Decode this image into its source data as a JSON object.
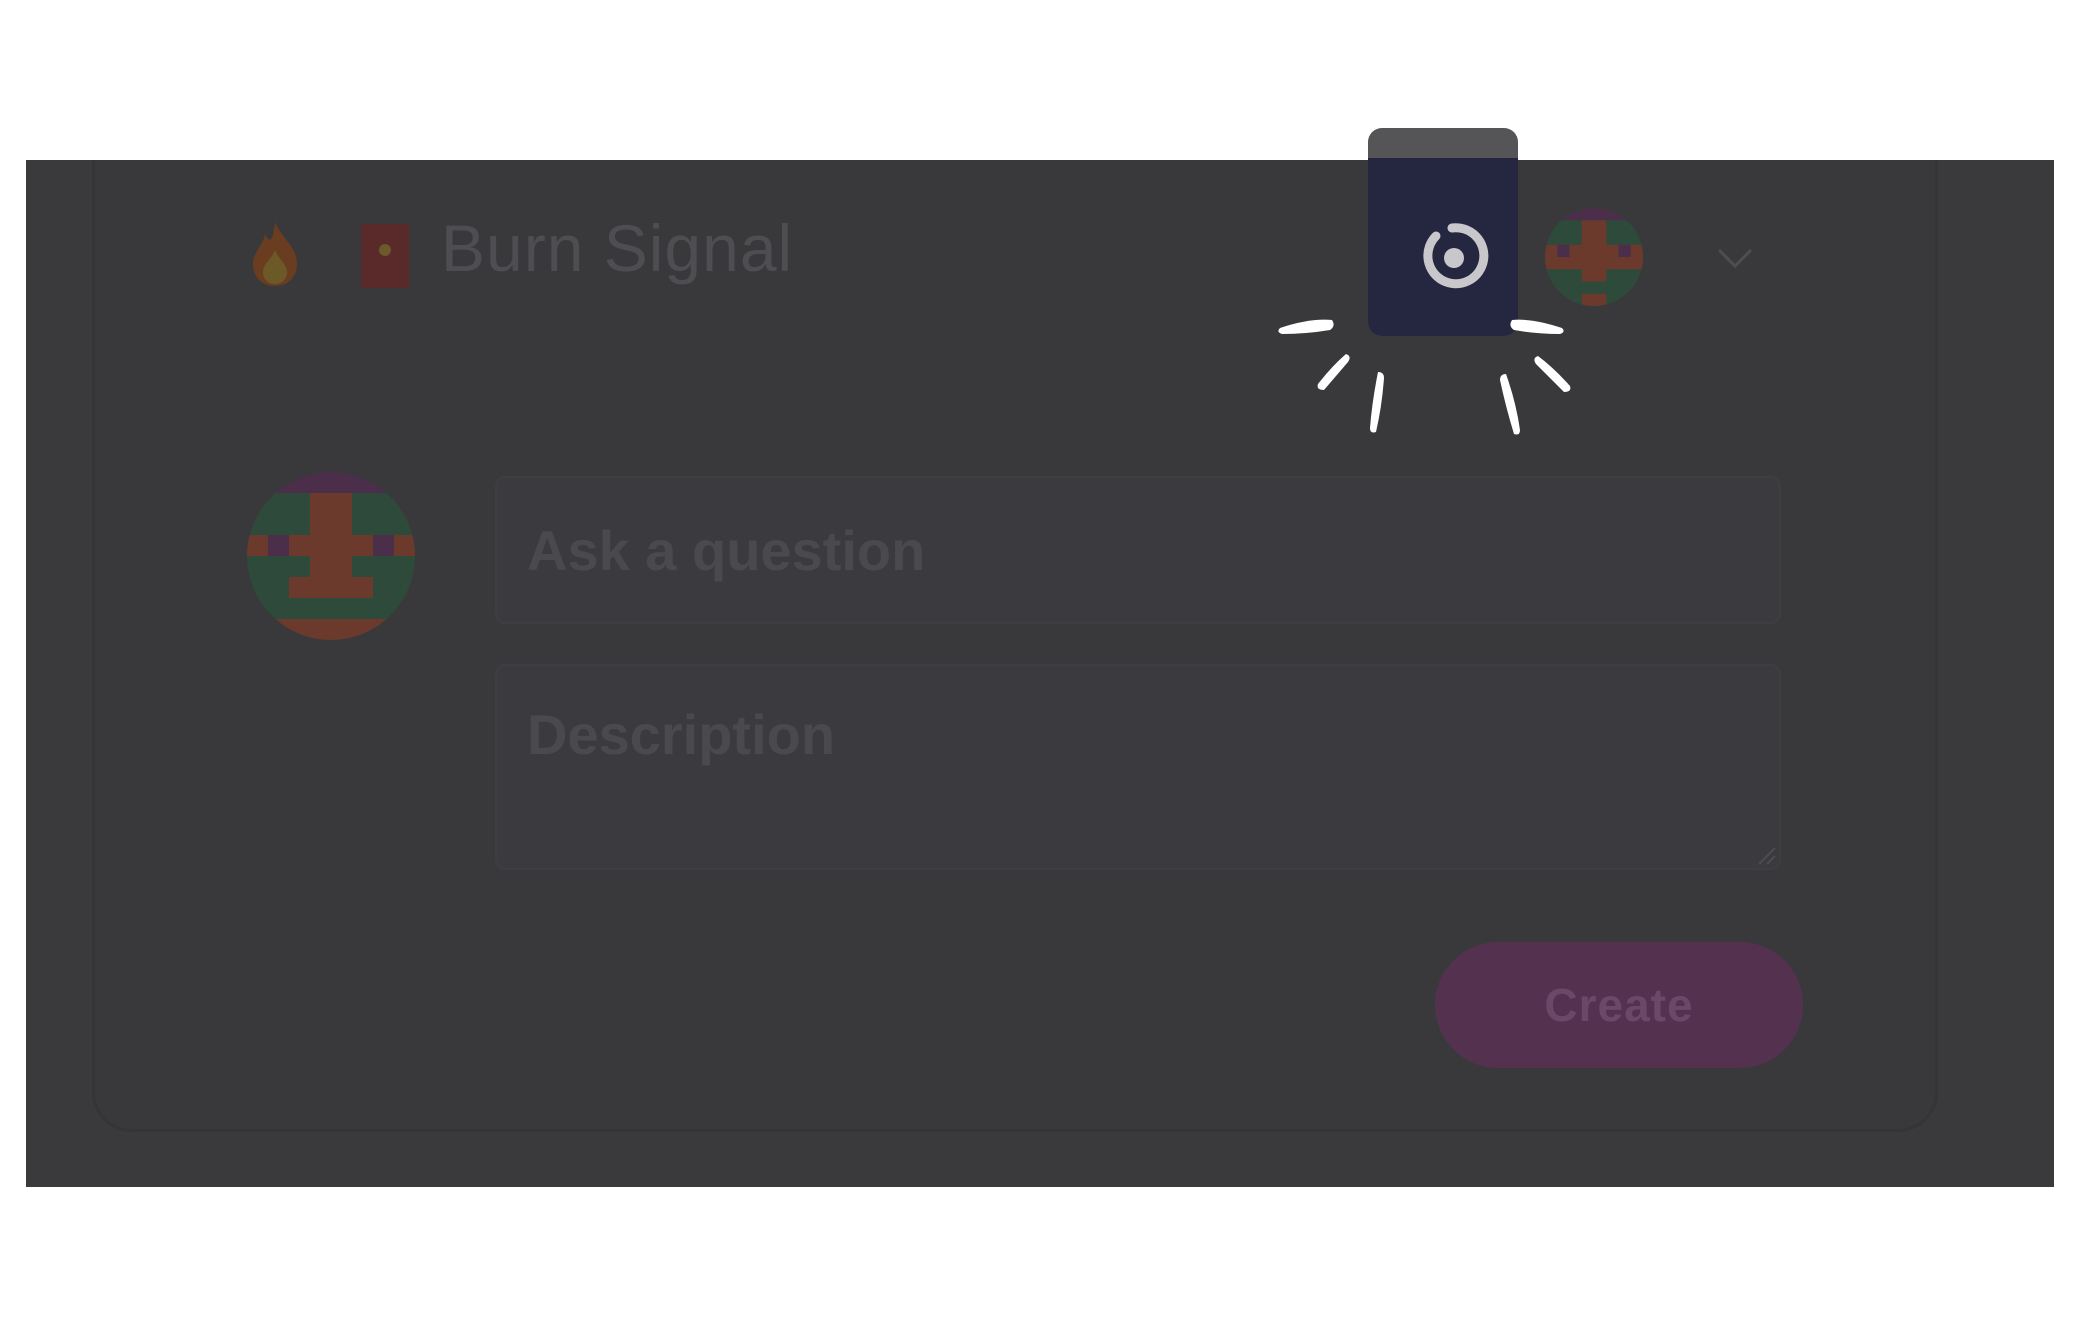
{
  "header": {
    "brand_title": "Burn Signal",
    "logo_icons": [
      "fire-icon",
      "red-envelope-icon"
    ],
    "account_menu_icon": "chevron-down-icon"
  },
  "spotlight": {
    "action_icon": "burn-signal-icon",
    "highlight_color": "#252640"
  },
  "composer": {
    "question_placeholder": "Ask a question",
    "description_placeholder": "Description",
    "create_label": "Create",
    "create_color": "#54324f"
  },
  "theme": {
    "overlay": "#3a3a3d",
    "avatar_colors": [
      "#2e4a3a",
      "#6b3a2c",
      "#4a2e4a"
    ]
  }
}
